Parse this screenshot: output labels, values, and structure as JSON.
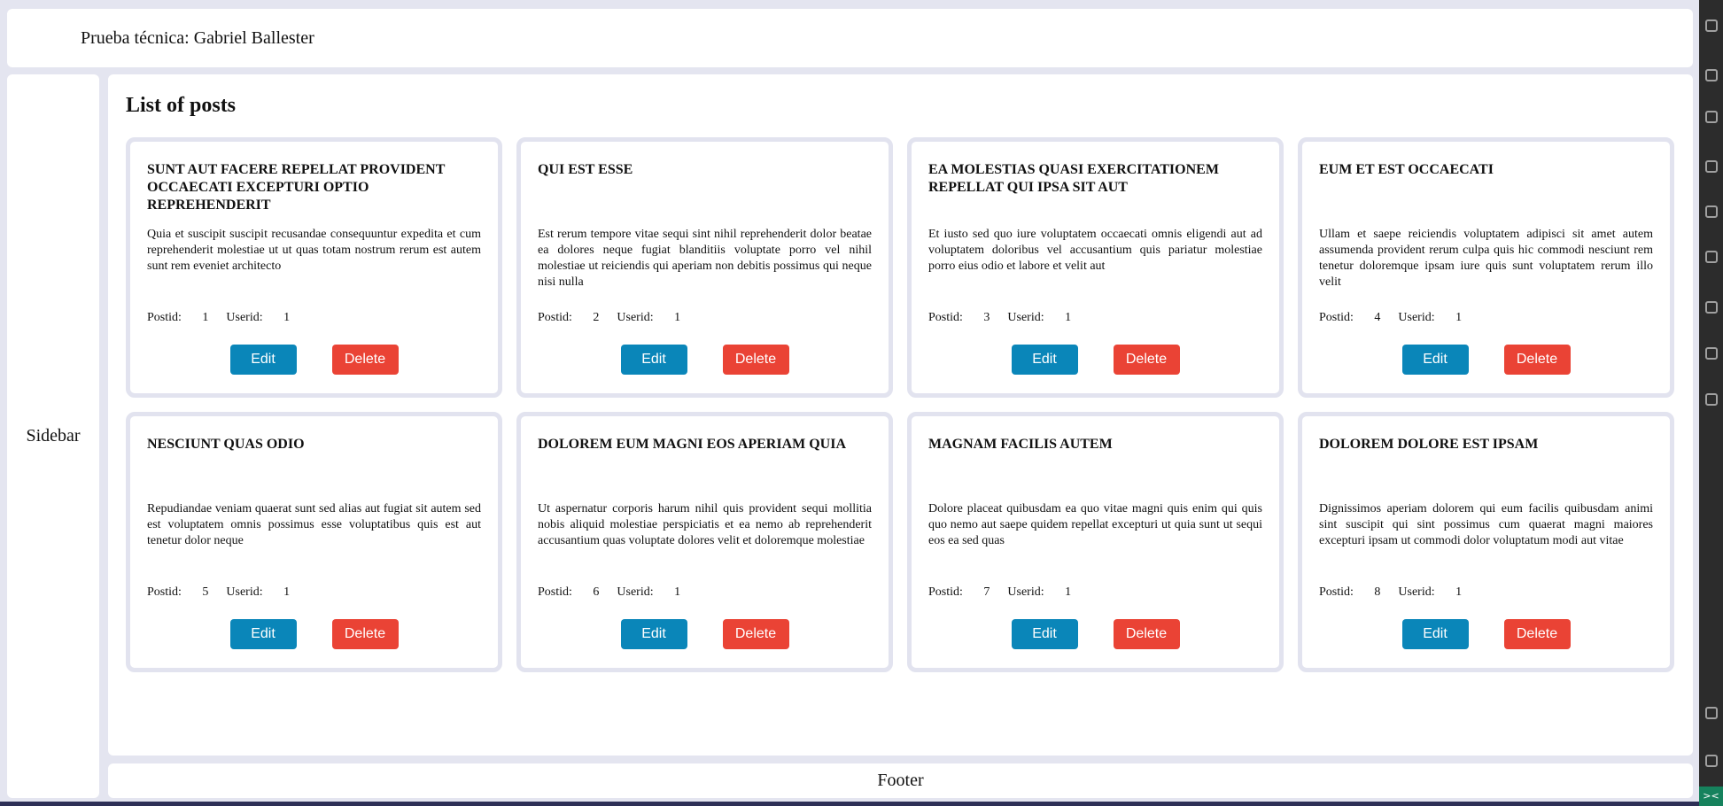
{
  "header": {
    "title": "Prueba técnica: Gabriel Ballester"
  },
  "sidebar": {
    "label": "Sidebar"
  },
  "main": {
    "heading": "List of posts"
  },
  "footer": {
    "label": "Footer"
  },
  "labels": {
    "postid": "Postid:",
    "userid": "Userid:",
    "edit": "Edit",
    "delete": "Delete"
  },
  "colors": {
    "edit_button": "#0a86b9",
    "delete_button": "#ea4335",
    "background": "#e4e5f0"
  },
  "right_strip": {
    "icons": [
      "source-control-icon",
      "debug-icon",
      "extensions-icon",
      "remote-icon",
      "test-icon",
      "book-icon",
      "docker-icon",
      "wifi-icon",
      "n-icon",
      "account-icon",
      "gear-icon"
    ],
    "status_text": "><"
  },
  "posts": [
    {
      "title": "sunt aut facere repellat provident occaecati excepturi optio reprehenderit",
      "body": "Quia et suscipit suscipit recusandae consequuntur expedita et cum reprehenderit molestiae ut ut quas totam nostrum rerum est autem sunt rem eveniet architecto",
      "postid": "1",
      "userid": "1"
    },
    {
      "title": "qui est esse",
      "body": "Est rerum tempore vitae sequi sint nihil reprehenderit dolor beatae ea dolores neque fugiat blanditiis voluptate porro vel nihil molestiae ut reiciendis qui aperiam non debitis possimus qui neque nisi nulla",
      "postid": "2",
      "userid": "1"
    },
    {
      "title": "ea molestias quasi exercitationem repellat qui ipsa sit aut",
      "body": "Et iusto sed quo iure voluptatem occaecati omnis eligendi aut ad voluptatem doloribus vel accusantium quis pariatur molestiae porro eius odio et labore et velit aut",
      "postid": "3",
      "userid": "1"
    },
    {
      "title": "eum et est occaecati",
      "body": "Ullam et saepe reiciendis voluptatem adipisci sit amet autem assumenda provident rerum culpa quis hic commodi nesciunt rem tenetur doloremque ipsam iure quis sunt voluptatem rerum illo velit",
      "postid": "4",
      "userid": "1"
    },
    {
      "title": "nesciunt quas odio",
      "body": "Repudiandae veniam quaerat sunt sed alias aut fugiat sit autem sed est voluptatem omnis possimus esse voluptatibus quis est aut tenetur dolor neque",
      "postid": "5",
      "userid": "1"
    },
    {
      "title": "dolorem eum magni eos aperiam quia",
      "body": "Ut aspernatur corporis harum nihil quis provident sequi mollitia nobis aliquid molestiae perspiciatis et ea nemo ab reprehenderit accusantium quas voluptate dolores velit et doloremque molestiae",
      "postid": "6",
      "userid": "1"
    },
    {
      "title": "magnam facilis autem",
      "body": "Dolore placeat quibusdam ea quo vitae magni quis enim qui quis quo nemo aut saepe quidem repellat excepturi ut quia sunt ut sequi eos ea sed quas",
      "postid": "7",
      "userid": "1"
    },
    {
      "title": "dolorem dolore est ipsam",
      "body": "Dignissimos aperiam dolorem qui eum facilis quibusdam animi sint suscipit qui sint possimus cum quaerat magni maiores excepturi ipsam ut commodi dolor voluptatum modi aut vitae",
      "postid": "8",
      "userid": "1"
    }
  ]
}
